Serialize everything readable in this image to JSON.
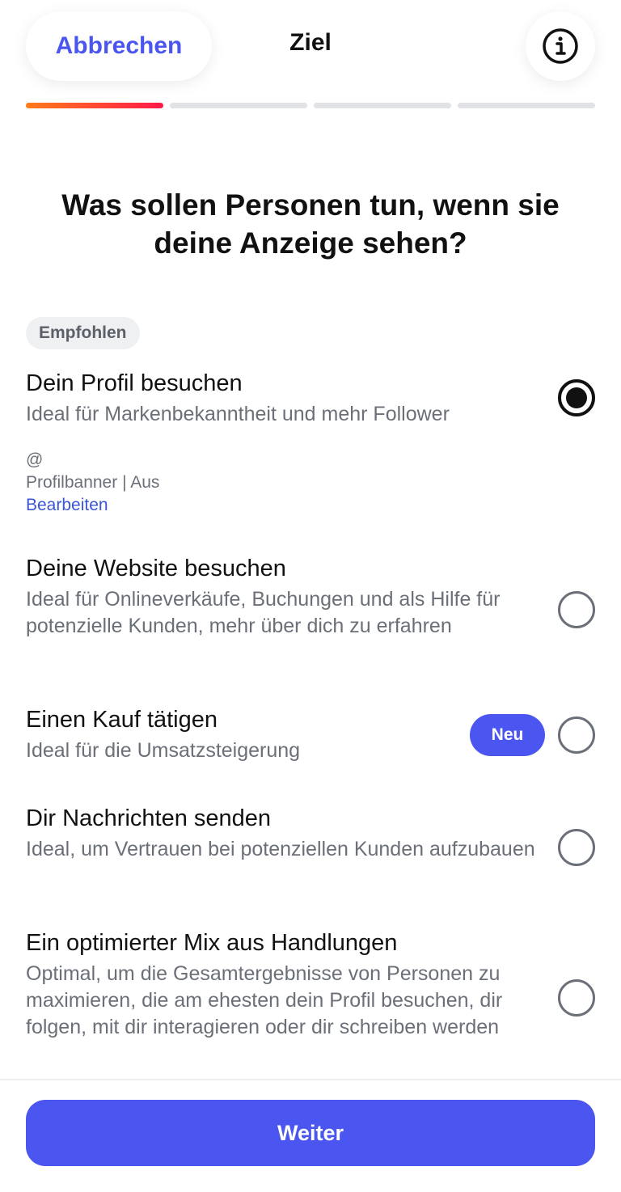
{
  "header": {
    "cancel_label": "Abbrechen",
    "title": "Ziel",
    "info_icon": "info-circle-icon",
    "progress_steps": 4,
    "progress_active": 1
  },
  "question": {
    "line1": "Was sollen Personen tun, wenn sie",
    "line2": "deine Anzeige sehen?"
  },
  "recommended_label": "Empfohlen",
  "options": [
    {
      "title": "Dein Profil besuchen",
      "description": "Ideal für Markenbekanntheit und mehr Follower",
      "selected": true
    },
    {
      "title": "Deine Website besuchen",
      "description": "Ideal für Onlineverkäufe, Buchungen und als Hilfe für potenzielle Kunden, mehr über dich zu erfahren",
      "selected": false
    },
    {
      "title": "Einen Kauf tätigen",
      "description": "Ideal für die Umsatzsteigerung",
      "badge": "Neu",
      "selected": false
    },
    {
      "title": "Dir Nachrichten senden",
      "description": "Ideal, um Vertrauen bei potenziellen Kunden aufzubauen",
      "selected": false
    },
    {
      "title": "Ein optimierter Mix aus Handlungen",
      "description": "Optimal, um die Gesamtergebnisse von Personen zu maximieren, die am ehesten dein Profil besuchen, dir folgen, mit dir interagieren oder dir schreiben werden",
      "selected": false
    }
  ],
  "profile": {
    "handle": "@",
    "banner": "Profilbanner | Aus",
    "edit_label": "Bearbeiten"
  },
  "footer": {
    "continue_label": "Weiter"
  },
  "colors": {
    "accent": "#4b56f0",
    "progress_gradient_start": "#ff7a1a",
    "progress_gradient_end": "#ff1a4a",
    "link": "#3a55d6"
  }
}
